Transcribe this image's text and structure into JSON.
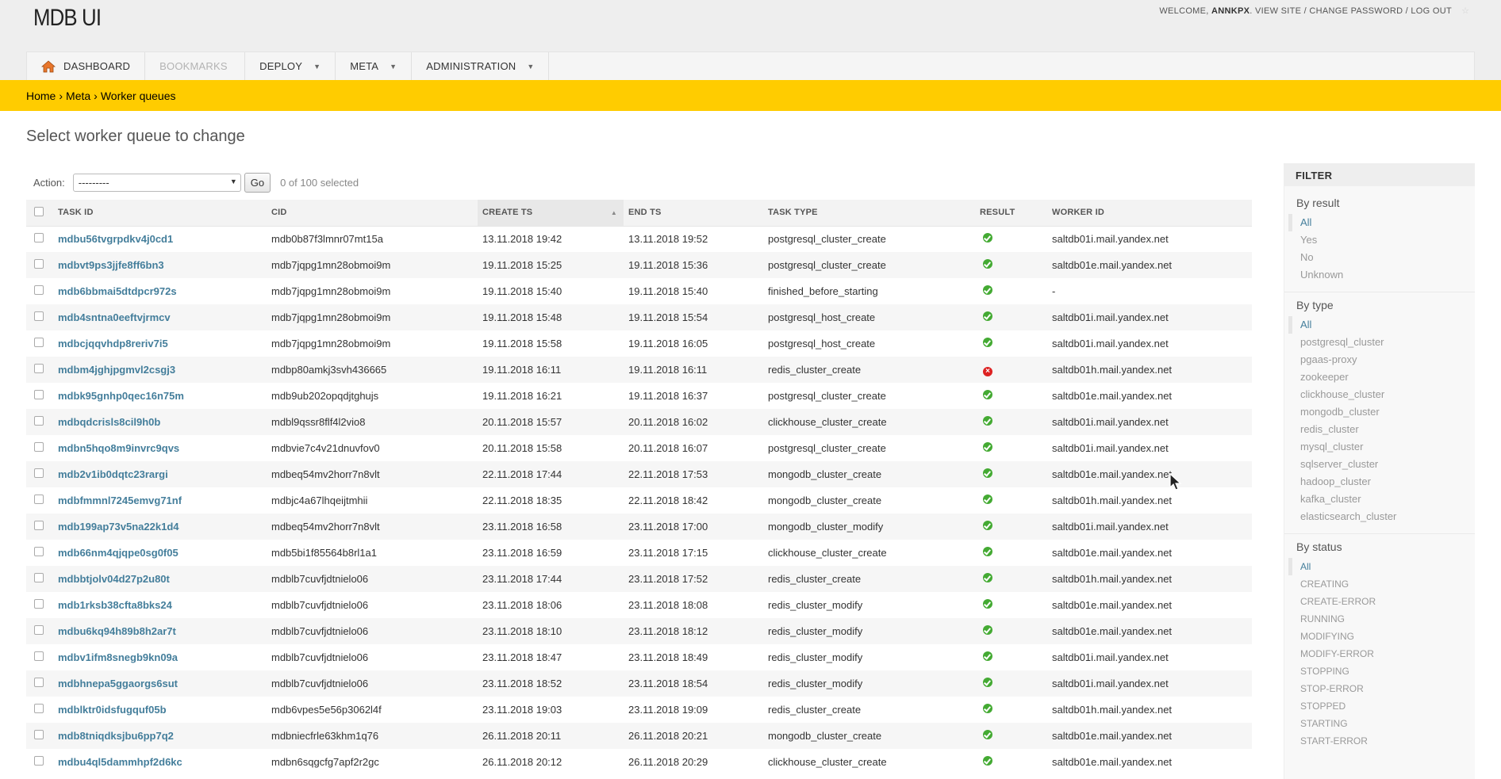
{
  "brand": "MDB UI",
  "user_tools": {
    "welcome": "WELCOME,",
    "username": "ANNKPX",
    "links": ". VIEW SITE / CHANGE PASSWORD / LOG OUT"
  },
  "nav": {
    "dashboard": "DASHBOARD",
    "bookmarks": "BOOKMARKS",
    "deploy": "DEPLOY",
    "meta": "META",
    "administration": "ADMINISTRATION"
  },
  "breadcrumbs": [
    "Home",
    "Meta",
    "Worker queues"
  ],
  "page_title": "Select worker queue to change",
  "actions": {
    "label": "Action:",
    "select_value": "---------",
    "go_label": "Go",
    "selected_text": "0 of 100 selected"
  },
  "table": {
    "columns": [
      "TASK ID",
      "CID",
      "CREATE TS",
      "END TS",
      "TASK TYPE",
      "RESULT",
      "WORKER ID"
    ],
    "rows": [
      [
        "mdbu56tvgrpdkv4j0cd1",
        "mdb0b87f3lmnr07mt15a",
        "13.11.2018 19:42",
        "13.11.2018 19:52",
        "postgresql_cluster_create",
        "ok",
        "saltdb01i.mail.yandex.net"
      ],
      [
        "mdbvt9ps3jjfe8ff6bn3",
        "mdb7jqpg1mn28obmoi9m",
        "19.11.2018 15:25",
        "19.11.2018 15:36",
        "postgresql_cluster_create",
        "ok",
        "saltdb01e.mail.yandex.net"
      ],
      [
        "mdb6bbmai5dtdpcr972s",
        "mdb7jqpg1mn28obmoi9m",
        "19.11.2018 15:40",
        "19.11.2018 15:40",
        "finished_before_starting",
        "ok",
        "-"
      ],
      [
        "mdb4sntna0eeftvjrmcv",
        "mdb7jqpg1mn28obmoi9m",
        "19.11.2018 15:48",
        "19.11.2018 15:54",
        "postgresql_host_create",
        "ok",
        "saltdb01i.mail.yandex.net"
      ],
      [
        "mdbcjqqvhdp8reriv7i5",
        "mdb7jqpg1mn28obmoi9m",
        "19.11.2018 15:58",
        "19.11.2018 16:05",
        "postgresql_host_create",
        "ok",
        "saltdb01i.mail.yandex.net"
      ],
      [
        "mdbm4jghjpgmvl2csgj3",
        "mdbp80amkj3svh436665",
        "19.11.2018 16:11",
        "19.11.2018 16:11",
        "redis_cluster_create",
        "error",
        "saltdb01h.mail.yandex.net"
      ],
      [
        "mdbk95gnhp0qec16n75m",
        "mdb9ub202opqdjtghujs",
        "19.11.2018 16:21",
        "19.11.2018 16:37",
        "postgresql_cluster_create",
        "ok",
        "saltdb01e.mail.yandex.net"
      ],
      [
        "mdbqdcrisls8cil9h0b",
        "mdbl9qssr8flf4l2vio8",
        "20.11.2018 15:57",
        "20.11.2018 16:02",
        "clickhouse_cluster_create",
        "ok",
        "saltdb01i.mail.yandex.net"
      ],
      [
        "mdbn5hqo8m9invrc9qvs",
        "mdbvie7c4v21dnuvfov0",
        "20.11.2018 15:58",
        "20.11.2018 16:07",
        "postgresql_cluster_create",
        "ok",
        "saltdb01i.mail.yandex.net"
      ],
      [
        "mdb2v1ib0dqtc23rargi",
        "mdbeq54mv2horr7n8vlt",
        "22.11.2018 17:44",
        "22.11.2018 17:53",
        "mongodb_cluster_create",
        "ok",
        "saltdb01e.mail.yandex.net"
      ],
      [
        "mdbfmmnl7245emvg71nf",
        "mdbjc4a67lhqeijtmhii",
        "22.11.2018 18:35",
        "22.11.2018 18:42",
        "mongodb_cluster_create",
        "ok",
        "saltdb01h.mail.yandex.net"
      ],
      [
        "mdb199ap73v5na22k1d4",
        "mdbeq54mv2horr7n8vlt",
        "23.11.2018 16:58",
        "23.11.2018 17:00",
        "mongodb_cluster_modify",
        "ok",
        "saltdb01i.mail.yandex.net"
      ],
      [
        "mdb66nm4qjqpe0sg0f05",
        "mdb5bi1f85564b8rl1a1",
        "23.11.2018 16:59",
        "23.11.2018 17:15",
        "clickhouse_cluster_create",
        "ok",
        "saltdb01e.mail.yandex.net"
      ],
      [
        "mdbbtjolv04d27p2u80t",
        "mdblb7cuvfjdtnielo06",
        "23.11.2018 17:44",
        "23.11.2018 17:52",
        "redis_cluster_create",
        "ok",
        "saltdb01h.mail.yandex.net"
      ],
      [
        "mdb1rksb38cfta8bks24",
        "mdblb7cuvfjdtnielo06",
        "23.11.2018 18:06",
        "23.11.2018 18:08",
        "redis_cluster_modify",
        "ok",
        "saltdb01e.mail.yandex.net"
      ],
      [
        "mdbu6kq94h89b8h2ar7t",
        "mdblb7cuvfjdtnielo06",
        "23.11.2018 18:10",
        "23.11.2018 18:12",
        "redis_cluster_modify",
        "ok",
        "saltdb01e.mail.yandex.net"
      ],
      [
        "mdbv1ifm8snegb9kn09a",
        "mdblb7cuvfjdtnielo06",
        "23.11.2018 18:47",
        "23.11.2018 18:49",
        "redis_cluster_modify",
        "ok",
        "saltdb01i.mail.yandex.net"
      ],
      [
        "mdbhnepa5ggaorgs6sut",
        "mdblb7cuvfjdtnielo06",
        "23.11.2018 18:52",
        "23.11.2018 18:54",
        "redis_cluster_modify",
        "ok",
        "saltdb01i.mail.yandex.net"
      ],
      [
        "mdblktr0idsfugquf05b",
        "mdb6vpes5e56p3062l4f",
        "23.11.2018 19:03",
        "23.11.2018 19:09",
        "redis_cluster_create",
        "ok",
        "saltdb01h.mail.yandex.net"
      ],
      [
        "mdb8tniqdksjbu6pp7q2",
        "mdbniecfrle63khm1q76",
        "26.11.2018 20:11",
        "26.11.2018 20:21",
        "mongodb_cluster_create",
        "ok",
        "saltdb01e.mail.yandex.net"
      ],
      [
        "mdbu4ql5dammhpf2d6kc",
        "mdbn6sqgcfg7apf2r2gc",
        "26.11.2018 20:12",
        "26.11.2018 20:29",
        "clickhouse_cluster_create",
        "ok",
        "saltdb01e.mail.yandex.net"
      ]
    ]
  },
  "filter": {
    "title": "FILTER",
    "groups": [
      {
        "title": "By result",
        "options": [
          "All",
          "Yes",
          "No",
          "Unknown"
        ]
      },
      {
        "title": "By type",
        "options": [
          "All",
          "postgresql_cluster",
          "pgaas-proxy",
          "zookeeper",
          "clickhouse_cluster",
          "mongodb_cluster",
          "redis_cluster",
          "mysql_cluster",
          "sqlserver_cluster",
          "hadoop_cluster",
          "kafka_cluster",
          "elasticsearch_cluster"
        ]
      },
      {
        "title": "By status",
        "options": [
          "All",
          "CREATING",
          "CREATE-ERROR",
          "RUNNING",
          "MODIFYING",
          "MODIFY-ERROR",
          "STOPPING",
          "STOP-ERROR",
          "STOPPED",
          "STARTING",
          "START-ERROR"
        ]
      }
    ]
  }
}
